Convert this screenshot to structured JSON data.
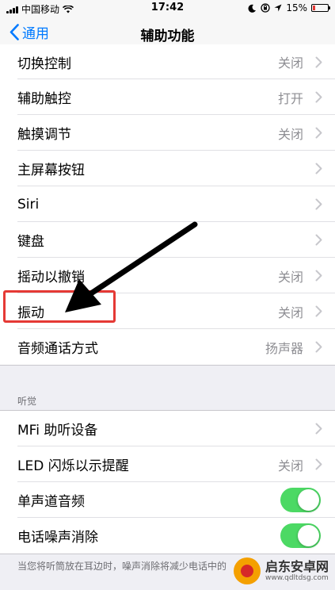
{
  "status_bar": {
    "carrier": "中国移动",
    "time": "17:42",
    "battery": "15%",
    "battery_level": 0.15
  },
  "nav": {
    "back_label": "通用",
    "title": "辅助功能"
  },
  "group1": [
    {
      "label": "切换控制",
      "value": "关闭"
    },
    {
      "label": "辅助触控",
      "value": "打开"
    },
    {
      "label": "触摸调节",
      "value": "关闭"
    },
    {
      "label": "主屏幕按钮",
      "value": ""
    },
    {
      "label": "Siri",
      "value": ""
    },
    {
      "label": "键盘",
      "value": ""
    },
    {
      "label": "摇动以撤销",
      "value": "关闭"
    },
    {
      "label": "振动",
      "value": "关闭"
    },
    {
      "label": "音频通话方式",
      "value": "扬声器"
    }
  ],
  "hearing": {
    "header": "听觉",
    "items": [
      {
        "label": "MFi 助听设备",
        "value": ""
      },
      {
        "label": "LED 闪烁以示提醒",
        "value": "关闭"
      },
      {
        "label": "单声道音频",
        "toggle": true
      },
      {
        "label": "电话噪声消除",
        "toggle": true
      }
    ],
    "footer": "当您将听筒放在耳边时，噪声消除将减少电话中的"
  },
  "watermark": {
    "name": "启东安卓网",
    "url": "www.qdltdsg.com"
  },
  "colors": {
    "accent": "#007aff",
    "toggle_on": "#4cd964",
    "highlight": "#e53935"
  }
}
